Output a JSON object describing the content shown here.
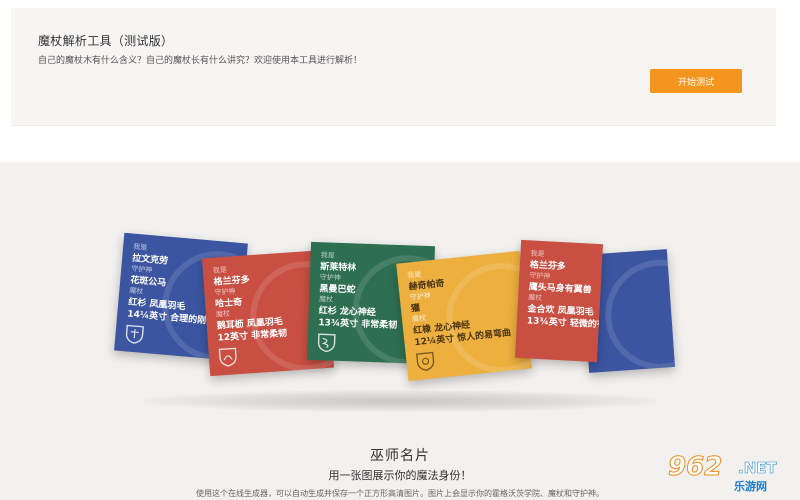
{
  "tool": {
    "title": "魔杖解析工具（测试版）",
    "description": "自己的魔杖木有什么含义？自己的魔杖长有什么讲究？欢迎使用本工具进行解析！",
    "start_label": "开始测试"
  },
  "cards": [
    {
      "color": "#3b55a1",
      "lines": [
        {
          "label": "我是",
          "value": "拉文克劳"
        },
        {
          "label": "守护神",
          "value": "花斑公马"
        },
        {
          "label": "魔杖",
          "value": "红杉 凤凰羽毛"
        },
        {
          "label": "",
          "value": "14¼英寸 合理的刚硬"
        }
      ]
    },
    {
      "color": "#c94f43",
      "lines": [
        {
          "label": "我是",
          "value": "格兰芬多"
        },
        {
          "label": "守护神",
          "value": "哈士奇"
        },
        {
          "label": "魔杖",
          "value": "鹅耳枥 凤凰羽毛"
        },
        {
          "label": "",
          "value": "12英寸 非常柔韧"
        }
      ]
    },
    {
      "color": "#2e6f52",
      "lines": [
        {
          "label": "我是",
          "value": "斯莱特林"
        },
        {
          "label": "守护神",
          "value": "黑曼巴蛇"
        },
        {
          "label": "魔杖",
          "value": "红杉 龙心神经"
        },
        {
          "label": "",
          "value": "13¾英寸 非常柔韧"
        }
      ]
    },
    {
      "color": "#edb03f",
      "lines": [
        {
          "label": "我是",
          "value": "赫奇帕奇"
        },
        {
          "label": "守护神",
          "value": "獾"
        },
        {
          "label": "魔杖",
          "value": "红橡 龙心神经"
        },
        {
          "label": "",
          "value": "12¼英寸 惊人的易弯曲"
        }
      ]
    },
    {
      "color": "#c94f43",
      "lines": [
        {
          "label": "我是",
          "value": "格兰芬多"
        },
        {
          "label": "守护神",
          "value": "鹰头马身有翼兽"
        },
        {
          "label": "魔杖",
          "value": "金合欢 凤凰羽毛"
        },
        {
          "label": "",
          "value": "13¾英寸 轻微的有弹性"
        }
      ]
    }
  ],
  "section": {
    "title": "巫师名片",
    "subtitle": "用一张图展示你的魔法身份！",
    "description": "使用这个在线生成器，可以自动生成并保存一个正方形高清图片。图片上会显示你的霍格沃茨学院、魔杖和守护神。"
  },
  "watermark": {
    "number": "962",
    "net": ".NET",
    "site": "乐游网"
  },
  "colors": {
    "accent": "#f4951e",
    "ravenclaw": "#3b55a1",
    "gryffindor": "#c94f43",
    "slytherin": "#2e6f52",
    "hufflepuff": "#edb03f"
  }
}
